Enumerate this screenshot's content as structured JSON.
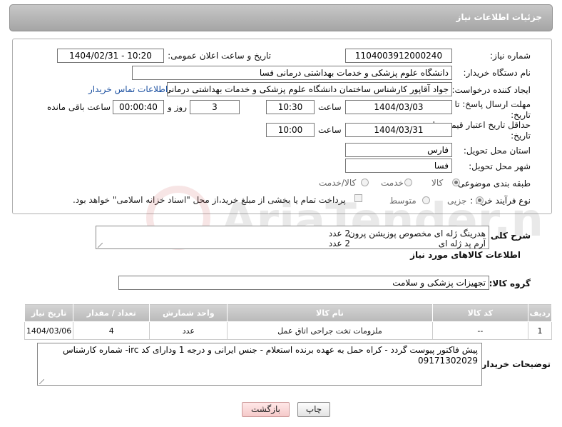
{
  "window": {
    "title": "جزئیات اطلاعات نیاز"
  },
  "form": {
    "need_number": {
      "label": "شماره نیاز:",
      "value": "1104003912000240"
    },
    "announce_datetime": {
      "label": "تاریخ و ساعت اعلان عمومی:",
      "value": "1404/02/31 - 10:20"
    },
    "buyer_org": {
      "label": "نام دستگاه خریدار:",
      "value": "دانشگاه علوم پزشکی و خدمات بهداشتی درمانی فسا"
    },
    "requester": {
      "label": "ایجاد کننده درخواست:",
      "value": "جواد آقاپور کارشناس ساختمان دانشگاه علوم پزشکی و خدمات بهداشتی درمانی فسا",
      "contact_link": "اطلاعات تماس خریدار"
    },
    "reply_deadline": {
      "label": "مهلت ارسال پاسخ: تا تاریخ:",
      "date": "1404/03/03",
      "time_label": "ساعت",
      "time": "10:30",
      "days": "3",
      "days_label": "روز و",
      "remaining": "00:00:40",
      "remaining_label": "ساعت باقی مانده"
    },
    "price_validity": {
      "label": "حداقل تاریخ اعتبار قیمت: تا تاریخ:",
      "date": "1404/03/31",
      "time_label": "ساعت",
      "time": "10:00"
    },
    "province": {
      "label": "استان محل تحویل:",
      "value": "فارس"
    },
    "city": {
      "label": "شهر محل تحویل:",
      "value": "فسا"
    },
    "category": {
      "label": "طبقه بندی موضوعی:",
      "options": [
        "کالا",
        "خدمت",
        "کالا/خدمت"
      ],
      "selected": "کالا"
    },
    "process": {
      "label": "نوع فرآیند خرید :",
      "options": [
        "جزیی",
        "متوسط"
      ],
      "selected": "جزیی",
      "payment_note": "پرداخت تمام یا بخشی از مبلغ خرید،از محل \"اسناد خزانه اسلامی\" خواهد بود."
    }
  },
  "summary": {
    "label": "شرح کلی نیاز:",
    "lines": [
      {
        "text": "هدرینگ ژله ای مخصوص پوزیشن پرون",
        "qty": "2 عدد"
      },
      {
        "text": "آرم پد ژله ای",
        "qty": "2 عدد"
      }
    ]
  },
  "goods_section": {
    "title": "اطلاعات کالاهای مورد نیاز"
  },
  "goods_group": {
    "label": "گروه کالا:",
    "value": "تجهیزات پزشکی و سلامت"
  },
  "goods_table": {
    "headers": [
      "ردیف",
      "کد کالا",
      "نام کالا",
      "واحد شمارش",
      "تعداد / مقدار",
      "تاریخ نیاز"
    ],
    "rows": [
      [
        "1",
        "--",
        "ملزومات تخت جراحی اتاق عمل",
        "عدد",
        "4",
        "1404/03/06"
      ]
    ]
  },
  "buyer_notes": {
    "label": "توضیحات خریدار:",
    "text": "پیش فاکتور پیوست گردد - کراه حمل به عهده برنده استعلام - جنس ایرانی و درجه 1 ودارای کد irc- شماره کارشناس 09171302029"
  },
  "buttons": {
    "print": "چاپ",
    "back": "بازگشت"
  },
  "watermark": {
    "brand": "AriaTender.neT"
  },
  "colors": {
    "titlebar": "#b5b5b5",
    "link": "#1a4fa0",
    "back_button": "#f5caca"
  }
}
